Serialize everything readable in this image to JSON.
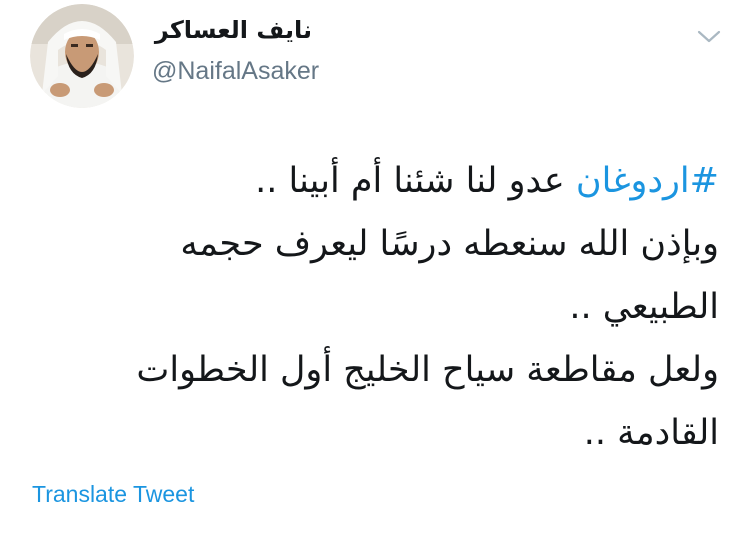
{
  "user": {
    "display_name": "نايف العساكر",
    "handle": "@NaifalAsaker"
  },
  "header": {
    "menu_icon": "chevron-down-icon"
  },
  "tweet": {
    "hashtag": "#اردوغان",
    "line1_rest": " عدو لنا شئنا أم أبينا ..",
    "line2": "وبإذن الله سنعطه درسًا ليعرف حجمه",
    "line3": "الطبيعي ..",
    "line4": "ولعل مقاطعة سياح الخليج أول الخطوات",
    "line5": "القادمة .."
  },
  "actions": {
    "translate_label": "Translate Tweet"
  },
  "colors": {
    "link": "#1b95e0",
    "text": "#14171a",
    "secondary": "#657786"
  }
}
